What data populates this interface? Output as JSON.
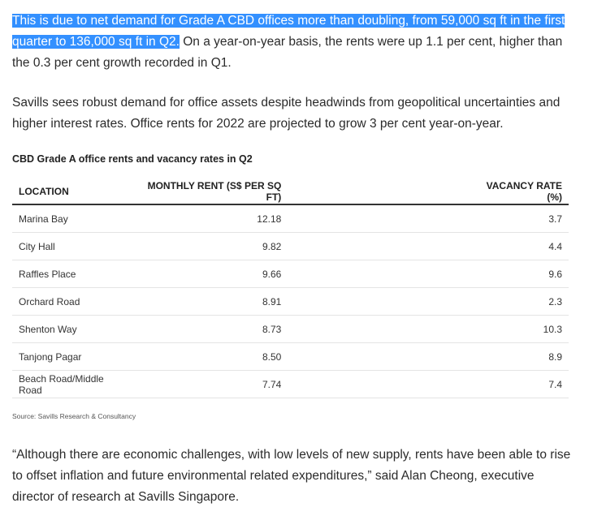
{
  "para1": {
    "highlighted": "This is due to net demand for Grade A CBD offices more than doubling, from 59,000 sq ft in the first quarter to 136,000 sq ft in Q2.",
    "rest": " On a year-on-year basis, the rents were up 1.1 per cent, higher than the 0.3 per cent growth recorded in Q1."
  },
  "para2": "Savills sees robust demand for office assets despite headwinds from geopolitical uncertainties and higher interest rates. Office rents for 2022 are projected to grow 3 per cent year-on-year.",
  "table": {
    "caption": "CBD Grade A office rents and vacancy rates in Q2",
    "headers": [
      "LOCATION",
      "MONTHLY RENT (S$ PER SQ FT)",
      "VACANCY RATE (%)"
    ],
    "rows": [
      [
        "Marina Bay",
        "12.18",
        "3.7"
      ],
      [
        "City Hall",
        "9.82",
        "4.4"
      ],
      [
        "Raffles Place",
        "9.66",
        "9.6"
      ],
      [
        "Orchard Road",
        "8.91",
        "2.3"
      ],
      [
        "Shenton Way",
        "8.73",
        "10.3"
      ],
      [
        "Tanjong Pagar",
        "8.50",
        "8.9"
      ],
      [
        "Beach Road/Middle Road",
        "7.74",
        "7.4"
      ]
    ],
    "source": "Source: Savills Research & Consultancy"
  },
  "para3": "“Although there are economic challenges, with low levels of new supply, rents have been able to rise to offset inflation and future environmental related expenditures,” said Alan Cheong, executive director of research at Savills Singapore.",
  "colors": {
    "highlight": "#3390ff"
  }
}
